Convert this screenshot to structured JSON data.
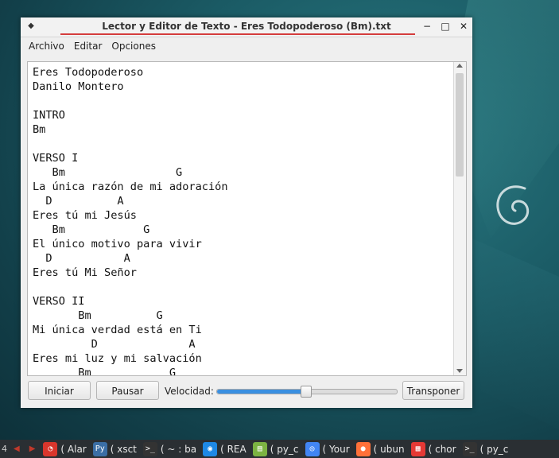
{
  "window": {
    "title": "Lector y Editor de Texto - Eres Todopoderoso (Bm).txt",
    "menu_icon": "◆",
    "minimize": "−",
    "maximize": "□",
    "close": "✕"
  },
  "menubar": {
    "items": [
      "Archivo",
      "Editar",
      "Opciones"
    ]
  },
  "editor": {
    "text": "Eres Todopoderoso\nDanilo Montero\n\nINTRO\nBm\n\nVERSO I\n   Bm                 G\nLa única razón de mi adoración\n  D          A\nEres tú mi Jesús\n   Bm            G\nEl único motivo para vivir\n  D           A\nEres tú Mi Señor\n\nVERSO II\n       Bm          G\nMi única verdad está en Ti\n         D              A\nEres mi luz y mi salvación\n       Bm            G"
  },
  "controls": {
    "start_label": "Iniciar",
    "pause_label": "Pausar",
    "speed_label": "Velocidad:",
    "speed_value_fraction": 0.49,
    "transpose_label": "Transponer"
  },
  "colors": {
    "title_accent": "#d43c3c",
    "slider_fill": "#3a8fe0",
    "taskbar_bg": "#2a2f33"
  },
  "taskbar": {
    "left_edge": "4",
    "tasks": [
      {
        "icon": "alarm-icon",
        "label": "( Alar"
      },
      {
        "icon": "python-icon",
        "label": "( xsct"
      },
      {
        "icon": "terminal-icon",
        "label": "( ~ : ba"
      },
      {
        "icon": "browser-icon",
        "label": "( REA"
      },
      {
        "icon": "files-icon",
        "label": "( py_c"
      },
      {
        "icon": "chrome-icon",
        "label": "( Your"
      },
      {
        "icon": "firefox-icon",
        "label": "( ubun"
      },
      {
        "icon": "apps-icon",
        "label": "( chor"
      },
      {
        "icon": "terminal-icon",
        "label": "( py_c"
      }
    ]
  }
}
